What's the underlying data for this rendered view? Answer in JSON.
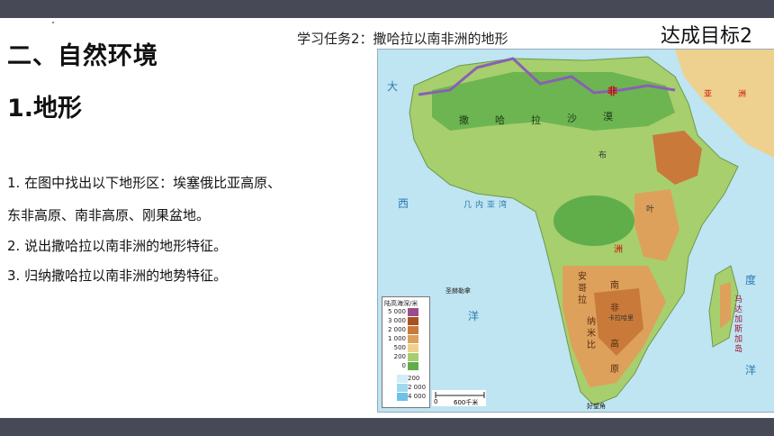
{
  "slide": {
    "heading": "二、自然环境",
    "subheading": "1.地形",
    "tasks": [
      "1. 在图中找出以下地形区：埃塞俄比亚高原、",
      "东非高原、南非高原、刚果盆地。",
      "2. 说出撒哈拉以南非洲的地形特征。",
      "3. 归纳撒哈拉以南非洲的地势特征。"
    ],
    "map_title": "学习任务2：撒哈拉以南非洲的地形",
    "goal_label": "达成目标2"
  },
  "map": {
    "labels": {
      "sahara": [
        "撒",
        "哈",
        "拉",
        "沙",
        "漠"
      ],
      "fei": "非",
      "asia": [
        "亚",
        "洲"
      ],
      "da": "大",
      "xi": "西",
      "guinea": [
        "几",
        "内",
        "亚",
        "湾"
      ],
      "africa_zhou": "洲",
      "angola": [
        "安",
        "哥",
        "拉"
      ],
      "nami": [
        "纳",
        "米",
        "比"
      ],
      "south_high": [
        "南",
        "非",
        "高",
        "原"
      ],
      "madagascar": [
        "马",
        "达",
        "加",
        "斯",
        "加",
        "岛"
      ],
      "indian_ocean": [
        "度",
        "洋"
      ],
      "yang": "洋",
      "ye": "叶",
      "st_helena": "圣赫勒拿",
      "bu": "布",
      "good_hope": "好望角",
      "kalahari": "卡拉哈里"
    },
    "legend": {
      "title": "陆高海深/米",
      "land": [
        "5 000",
        "3 000",
        "2 000",
        "1 000",
        "500",
        "200",
        "0"
      ],
      "sea": [
        "200",
        "2 000",
        "4 000"
      ],
      "land_colors": [
        "#9b4c8a",
        "#a8521f",
        "#c97a3a",
        "#dda15c",
        "#eed18f",
        "#a7cf6d",
        "#5fae4a"
      ],
      "sea_colors": [
        "#cfeef8",
        "#9fd8ef",
        "#6fc1e6"
      ]
    },
    "scale": {
      "zero": "0",
      "distance": "600千米"
    },
    "colors": {
      "sea": "#bfe4f2",
      "lowland": "#5fae4a",
      "plain": "#a7cf6d",
      "plateau": "#dda15c",
      "highland": "#c97a3a",
      "border": "#8a60b4"
    }
  }
}
